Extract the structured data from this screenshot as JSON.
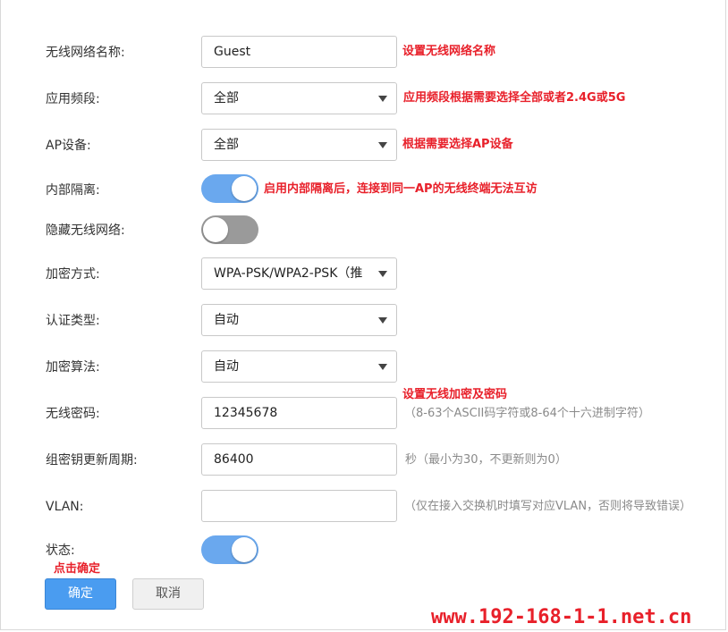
{
  "form": {
    "ssid": {
      "label": "无线网络名称:",
      "value": "Guest",
      "note": "设置无线网络名称"
    },
    "band": {
      "label": "应用频段:",
      "value": "全部",
      "note": "应用频段根据需要选择全部或者2.4G或5G"
    },
    "ap": {
      "label": "AP设备:",
      "value": "全部",
      "note": "根据需要选择AP设备"
    },
    "isolation": {
      "label": "内部隔离:",
      "state": "on",
      "note": "启用内部隔离后，连接到同一AP的无线终端无法互访"
    },
    "hidden": {
      "label": "隐藏无线网络:",
      "state": "off"
    },
    "encryption": {
      "label": "加密方式:",
      "value": "WPA-PSK/WPA2-PSK（推"
    },
    "auth": {
      "label": "认证类型:",
      "value": "自动"
    },
    "algorithm": {
      "label": "加密算法:",
      "value": "自动"
    },
    "password": {
      "label": "无线密码:",
      "value": "12345678",
      "note": "设置无线加密及密码",
      "hint": "（8-63个ASCII码字符或8-64个十六进制字符）"
    },
    "rekey": {
      "label": "组密钥更新周期:",
      "value": "86400",
      "hint": "秒（最小为30，不更新则为0）"
    },
    "vlan": {
      "label": "VLAN:",
      "value": "",
      "hint": "（仅在接入交换机时填写对应VLAN，否则将导致错误）"
    },
    "status": {
      "label": "状态:",
      "state": "on"
    }
  },
  "annotations": {
    "click_confirm": "点击确定"
  },
  "buttons": {
    "confirm": "确定",
    "cancel": "取消"
  },
  "watermark": "www.192-168-1-1.net.cn",
  "colors": {
    "accent": "#4a9cf0",
    "toggle_on": "#6aa8ee",
    "toggle_off": "#9a9a9a",
    "annotation_red": "#e8202a"
  }
}
